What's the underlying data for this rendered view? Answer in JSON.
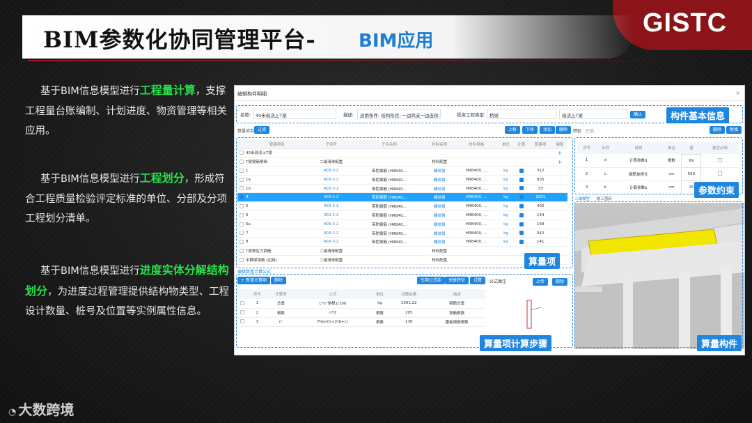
{
  "slide": {
    "title": "BIM参数化协同管理平台-",
    "subtitle": "BIM应用",
    "logo": "GISTC",
    "watermark": "大数跨境",
    "paragraphs": [
      {
        "pre": "基于BIM信息模型进行",
        "hl": "工程量计算",
        "post": "，支撑工程量台账编制、计划进度、物资管理等相关应用。"
      },
      {
        "pre": "基于BIM信息模型进行",
        "hl": "工程划分",
        "post": "，形成符合工程质量检验评定标准的单位、分部及分项工程划分清单。"
      },
      {
        "pre": "基于BIM信息模型进行",
        "hl": "进度实体分解结构划分",
        "post": "，为进度过程管理提供结构物类型、工程设计数量、桩号及位置等实例属性信息。"
      }
    ],
    "accent_color": "#1f86e0",
    "highlight_color": "#28e04a"
  },
  "panel": {
    "header": "编辑构件明细",
    "close_icon": "×",
    "info": {
      "name_label": "名称:",
      "name_value": "40米现浇上T梁",
      "desc_label": "描述:",
      "desc_value": "适用条件: 结构形式: 一边简支一边连续; ",
      "type_label": "投资工程类型:",
      "type_value": "桥梁",
      "type2_value": "现浇上T梁",
      "confirm": "确认"
    },
    "labels": {
      "basic": "构件基本信息",
      "params": "参数约束",
      "items": "算量项",
      "steps": "算量项计算步骤",
      "component": "算量构件"
    },
    "toolbar": {
      "left_label": "算量项目",
      "left_btn": "过滤",
      "up": "上移",
      "down": "下移",
      "add": "添加",
      "delete": "删除",
      "feature": "特征",
      "check": "已选",
      "r1": "删除",
      "r2": "新增"
    },
    "grid_headers": [
      "算量项目",
      "子目号",
      "子目名称",
      "材料名称",
      "材料规格",
      "单位",
      "计算",
      "算量项",
      "编辑"
    ],
    "grid_rows": [
      {
        "name": "40米现浇上T梁",
        "code": "",
        "sub": "",
        "mat": "",
        "spec": "",
        "unit": "",
        "calc": false,
        "qty": "",
        "sel": false
      },
      {
        "name": "T梁钢筋明细",
        "code": "二级清单配置",
        "sub": "",
        "mat": "材料配置",
        "spec": "",
        "unit": "",
        "calc": false,
        "qty": "",
        "sel": false
      },
      {
        "name": "1",
        "code": "403-3-2",
        "sub": "带肋钢筋 (HRB40...",
        "mat": "螺纹钢",
        "spec": "HRB400, ...",
        "unit": "kg",
        "calc": true,
        "qty": "312",
        "sel": false
      },
      {
        "name": "1a",
        "code": "403-3-2",
        "sub": "带肋钢筋 (HRB40...",
        "mat": "螺纹钢",
        "spec": "HRB400, ...",
        "unit": "kg",
        "calc": true,
        "qty": "935",
        "sel": false
      },
      {
        "name": "1b",
        "code": "403-3-2",
        "sub": "带肋钢筋 (HRB40...",
        "mat": "螺纹钢",
        "spec": "HRB400, ...",
        "unit": "kg",
        "calc": true,
        "qty": "33",
        "sel": false
      },
      {
        "name": "4",
        "code": "403-3-2",
        "sub": "带肋钢筋 (HRB40...",
        "mat": "螺纹钢",
        "spec": "HRB400, ...",
        "unit": "kg",
        "calc": true,
        "qty": "1001",
        "sel": true
      },
      {
        "name": "5",
        "code": "403-3-2",
        "sub": "带肋钢筋 (HRB40...",
        "mat": "螺纹钢",
        "spec": "HRB400, ...",
        "unit": "kg",
        "calc": true,
        "qty": "402",
        "sel": false
      },
      {
        "name": "6",
        "code": "403-3-2",
        "sub": "带肋钢筋 (HRB40...",
        "mat": "螺纹钢",
        "spec": "HRB400, ...",
        "unit": "kg",
        "calc": true,
        "qty": "144",
        "sel": false
      },
      {
        "name": "6a",
        "code": "403-3-2",
        "sub": "带肋钢筋 (HRB40...",
        "mat": "螺纹钢",
        "spec": "HRB400, ...",
        "unit": "kg",
        "calc": true,
        "qty": "168",
        "sel": false
      },
      {
        "name": "7",
        "code": "403-3-2",
        "sub": "带肋钢筋 (HRB40...",
        "mat": "螺纹钢",
        "spec": "HRB400, ...",
        "unit": "kg",
        "calc": true,
        "qty": "342",
        "sel": false
      },
      {
        "name": "8",
        "code": "403-3-2",
        "sub": "带肋钢筋 (HRB40...",
        "mat": "螺纹钢",
        "spec": "HRB400, ...",
        "unit": "kg",
        "calc": true,
        "qty": "141",
        "sel": false
      },
      {
        "name": "T梁预应力钢筋",
        "code": "二级清单配置",
        "sub": "",
        "mat": "材料配置",
        "spec": "",
        "unit": "",
        "calc": false,
        "qty": "",
        "sel": false
      },
      {
        "name": "中横梁钢筋 (边跨)",
        "code": "二级清单配置",
        "sub": "",
        "mat": "材料配置",
        "spec": "",
        "unit": "",
        "calc": false,
        "qty": "",
        "sel": false
      }
    ],
    "param_headers": [
      "序号",
      "名称",
      "说明",
      "单位",
      "值",
      "是否必填"
    ],
    "param_rows": [
      {
        "no": "1",
        "name": "d",
        "desc": "计算参数d",
        "unit": "根数",
        "val": "69"
      },
      {
        "no": "2",
        "name": "L",
        "desc": "钢筋单根长",
        "unit": "cm",
        "val": "550"
      },
      {
        "no": "3",
        "name": "b",
        "desc": "计算参数b",
        "unit": "cm",
        "val": "15"
      }
    ],
    "view_tabs": [
      "三维模型",
      "施工图纸"
    ],
    "bottom_title": "编辑算量计算公式",
    "bottom_btns": {
      "add": "新增计算项",
      "del": "删除",
      "ref": "引用公式库",
      "save": "关联特征",
      "test": "试算",
      "up": "上传",
      "del2": "删除",
      "formula_label": "公式图注"
    },
    "step_headers": [
      "序号",
      "计算项",
      "公式",
      "单位",
      "试算结果",
      "描述"
    ],
    "step_rows": [
      {
        "no": "1",
        "item": "总重",
        "formula": "L*n*单根1/100",
        "unit": "kg",
        "res": "1001.22",
        "desc": "钢筋总重"
      },
      {
        "no": "2",
        "item": "根数",
        "formula": "n*d",
        "unit": "根数",
        "res": "205",
        "desc": "钢筋根数"
      },
      {
        "no": "3",
        "item": "n'",
        "formula": "Floor(h-c)/(b+c)",
        "unit": "根数",
        "res": "136",
        "desc": "腹板钢筋根数"
      }
    ]
  }
}
